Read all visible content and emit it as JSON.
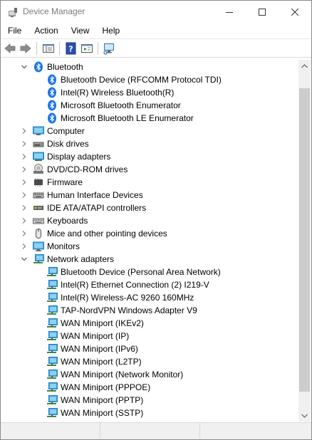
{
  "window": {
    "title": "Device Manager"
  },
  "menu": [
    "File",
    "Action",
    "View",
    "Help"
  ],
  "tree": {
    "bluetooth": {
      "label": "Bluetooth",
      "children": [
        "Bluetooth Device (RFCOMM Protocol TDI)",
        "Intel(R) Wireless Bluetooth(R)",
        "Microsoft Bluetooth Enumerator",
        "Microsoft Bluetooth LE Enumerator"
      ]
    },
    "categories": [
      "Computer",
      "Disk drives",
      "Display adapters",
      "DVD/CD-ROM drives",
      "Firmware",
      "Human Interface Devices",
      "IDE ATA/ATAPI controllers",
      "Keyboards",
      "Mice and other pointing devices",
      "Monitors"
    ],
    "network": {
      "label": "Network adapters",
      "children": [
        "Bluetooth Device (Personal Area Network)",
        "Intel(R) Ethernet Connection (2) I219-V",
        "Intel(R) Wireless-AC 9260 160MHz",
        "TAP-NordVPN Windows Adapter V9",
        "WAN Miniport (IKEv2)",
        "WAN Miniport (IP)",
        "WAN Miniport (IPv6)",
        "WAN Miniport (L2TP)",
        "WAN Miniport (Network Monitor)",
        "WAN Miniport (PPPOE)",
        "WAN Miniport (PPTP)",
        "WAN Miniport (SSTP)"
      ]
    }
  },
  "colors": {
    "bluetooth": "#1b74e8",
    "monitor": "#3aa3e3",
    "window_chrome": "#ffffff"
  }
}
